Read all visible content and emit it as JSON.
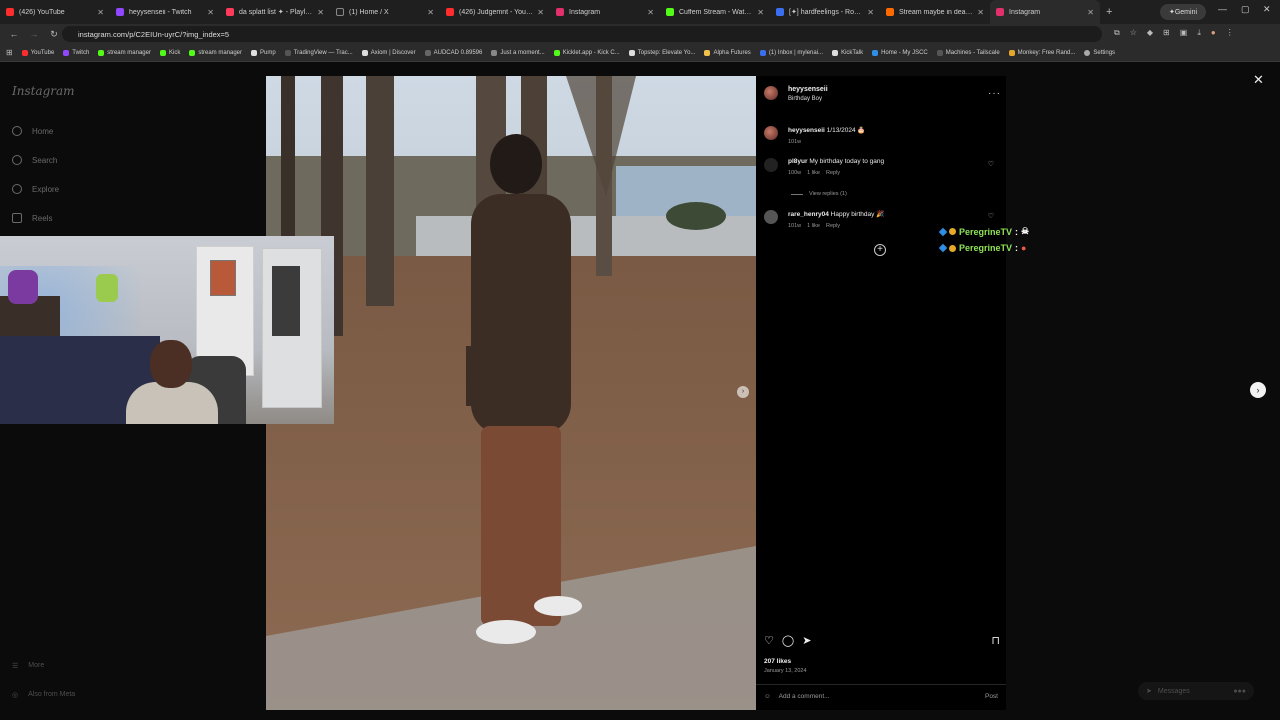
{
  "browser": {
    "tabs": [
      {
        "title": "(426) YouTube",
        "color": "#ff2d2d"
      },
      {
        "title": "heyysenseii - Twitch",
        "color": "#9146ff"
      },
      {
        "title": "da splatt list ✦ - Playlist - Apple Music",
        "color": "#ff3b5c"
      },
      {
        "title": "(1) Home / X",
        "color": "#222222"
      },
      {
        "title": "(426) Judgemnt - YouTube",
        "color": "#ff2d2d"
      },
      {
        "title": "Instagram",
        "color": "#e1306c"
      },
      {
        "title": "Cuffem Stream - Watch Live",
        "color": "#53fc18"
      },
      {
        "title": "[✦] hardfeelings - Roblox",
        "color": "#3a6ff0"
      },
      {
        "title": "Stream maybe in death by C...",
        "color": "#ff6a00"
      },
      {
        "title": "Instagram",
        "color": "#e1306c"
      }
    ],
    "gemini_label": "Gemini",
    "url": "instagram.com/p/C2EIUn-uyrC/?img_index=5",
    "bookmarks": [
      {
        "label": "YouTube",
        "color": "#ff2d2d"
      },
      {
        "label": "Twitch",
        "color": "#9146ff"
      },
      {
        "label": "stream manager",
        "color": "#53fc18"
      },
      {
        "label": "Kick",
        "color": "#53fc18"
      },
      {
        "label": "stream manager",
        "color": "#53fc18"
      },
      {
        "label": "Pump",
        "color": "#e0e0e0"
      },
      {
        "label": "TradingView — Trac...",
        "color": "#222222"
      },
      {
        "label": "Axiom | Discover",
        "color": "#dddddd"
      },
      {
        "label": "AUDCAD 0.89596",
        "color": "#444444"
      },
      {
        "label": "Just a moment...",
        "color": "#888888"
      },
      {
        "label": "Kicklet.app - Kick C...",
        "color": "#53fc18"
      },
      {
        "label": "Topstep: Elevate Yo...",
        "color": "#dddddd"
      },
      {
        "label": "Alpha Futures",
        "color": "#f0c14b"
      },
      {
        "label": "(1) Inbox | mylenai...",
        "color": "#3a6ff0"
      },
      {
        "label": "KickTalk",
        "color": "#dddddd"
      },
      {
        "label": "Home - My JSCC",
        "color": "#2d8fe6"
      },
      {
        "label": "Machines - Tailscale",
        "color": "#222222"
      },
      {
        "label": "Monkey: Free Rand...",
        "color": "#e6a72d"
      },
      {
        "label": "Settings",
        "color": "#aaaaaa"
      }
    ]
  },
  "instagram": {
    "logo": "Instagram",
    "nav": [
      {
        "label": "Home",
        "icon": "home-icon"
      },
      {
        "label": "Search",
        "icon": "search-icon"
      },
      {
        "label": "Explore",
        "icon": "explore-icon"
      },
      {
        "label": "Reels",
        "icon": "reels-icon"
      }
    ],
    "more_label": "More",
    "also_meta_label": "Also from Meta",
    "post": {
      "username": "heyysenseii",
      "subtitle": "Birthday Boy",
      "caption_user": "heyysenseii",
      "caption_text": "1/13/2024 🎂",
      "caption_age": "101w",
      "comments": [
        {
          "user": "pl8yur",
          "text": "My birthday today to gang",
          "age": "100w",
          "likes": "1 like",
          "reply": "Reply"
        },
        {
          "user": "rare_henry04",
          "text": "Happy birthday 🎉",
          "age": "101w",
          "likes": "1 like",
          "reply": "Reply"
        }
      ],
      "view_replies": "View replies (1)",
      "likes": "207 likes",
      "date": "January 13, 2024",
      "add_comment_placeholder": "Add a comment...",
      "post_label": "Post"
    },
    "messages_label": "Messages"
  },
  "overlay_chat": [
    {
      "user": "PeregrineTV",
      "sep": ":"
    },
    {
      "user": "PeregrineTV",
      "sep": ":"
    }
  ]
}
